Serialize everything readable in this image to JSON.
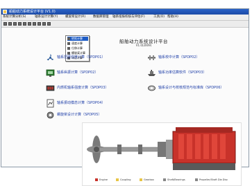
{
  "window": {
    "title": "船舶动力系统设计平台 (V1.0)"
  },
  "menu": [
    "系统计算分析(S)",
    "轴系设计计算(Y)",
    "螺旋桨设计(R)",
    "数据库管理",
    "轴系扭振校核与评估(F)",
    "工具(O)",
    "帮助(H)"
  ],
  "dropdown": [
    {
      "label": "转矩计算",
      "selected": true
    },
    {
      "label": "速度计算",
      "selected": false
    },
    {
      "label": "位移计算",
      "selected": false
    },
    {
      "label": "螺旋桨计算",
      "selected": false
    },
    {
      "label": "冰区计算",
      "selected": false
    }
  ],
  "header": {
    "title": "船舶动力系统设计平台",
    "subtitle": "V1.0(2009)"
  },
  "functions": [
    {
      "label": "轴系扭振强度计算（SPDP01）",
      "icon": "propeller-icon"
    },
    {
      "label": "轴系校中计算（SPDP02）",
      "icon": "shaft-alignment-icon"
    },
    {
      "label": "轴系纵振计算（SPDP02）",
      "icon": "monitor-icon"
    },
    {
      "label": "轴系功率估算软件（SPDP03）",
      "icon": "ship-icon"
    },
    {
      "label": "内燃机轴系强度计算（SPDP03）",
      "icon": "engine-icon"
    },
    {
      "label": "轴系设计与校核规范与标准库（SPDP06）",
      "icon": "bearing-icon"
    },
    {
      "label": "轴系振动模态计算（SPDP04）",
      "icon": "document-icon"
    },
    {
      "label": "螺旋桨设计计算（SPDP05）",
      "icon": "gear-icon"
    }
  ],
  "legend": [
    "Engine",
    "Coupling",
    "Gearbox",
    "Shaft/Bearings",
    "Propeller/Shaft Dia Disc"
  ],
  "colors": {
    "titlebar": "#1f55b8",
    "link": "#1f3fa8",
    "engine": "#c8322a",
    "shaft": "#8a8a8a",
    "accent": "#d9d9d9"
  }
}
